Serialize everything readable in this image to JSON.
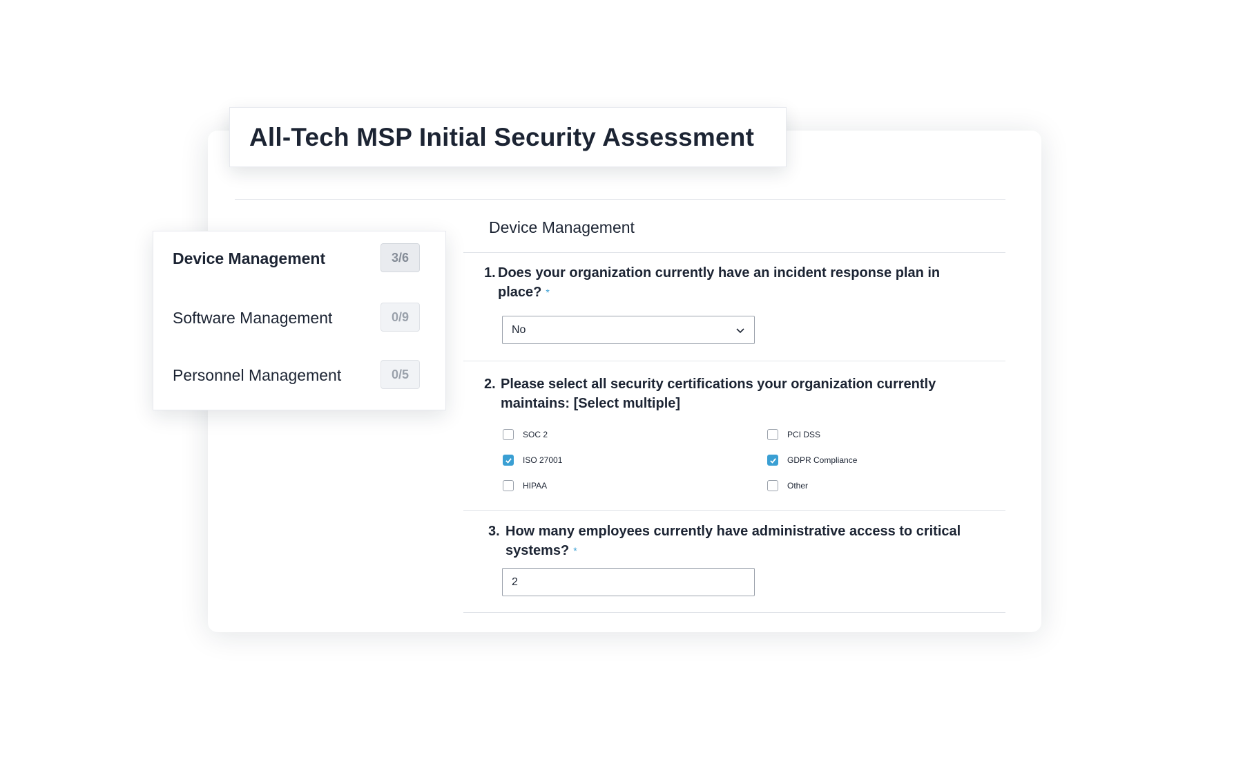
{
  "form": {
    "title": "All-Tech MSP Initial Security Assessment"
  },
  "sidebar": {
    "items": [
      {
        "label": "Device Management",
        "badge": "3/6",
        "active": true
      },
      {
        "label": "Software Management",
        "badge": "0/9",
        "active": false
      },
      {
        "label": "Personnel Management",
        "badge": "0/5",
        "active": false
      }
    ]
  },
  "section": {
    "heading": "Device Management"
  },
  "questions": [
    {
      "number": "1.",
      "text": "Does your organization currently have an incident response plan in place?",
      "required_marker": "*",
      "type": "select",
      "value": "No",
      "icon": "chevron-down-icon"
    },
    {
      "number": "2.",
      "text": "Please select all security certifications your organization currently maintains: [Select multiple]",
      "type": "checkbox-group",
      "options": [
        {
          "label": "SOC 2",
          "checked": false
        },
        {
          "label": "PCI DSS",
          "checked": false
        },
        {
          "label": "ISO 27001",
          "checked": true
        },
        {
          "label": "GDPR Compliance",
          "checked": true
        },
        {
          "label": "HIPAA",
          "checked": false
        },
        {
          "label": "Other",
          "checked": false
        }
      ]
    },
    {
      "number": "3.",
      "text": "How many employees currently have administrative access to critical systems?",
      "required_marker": "*",
      "type": "text",
      "value": "2"
    }
  ],
  "colors": {
    "accent": "#3a9fd3",
    "text": "#1c2433",
    "badge_text": "#9aa1ab",
    "border": "#9aa1ab",
    "divider": "#e1e4e9"
  }
}
